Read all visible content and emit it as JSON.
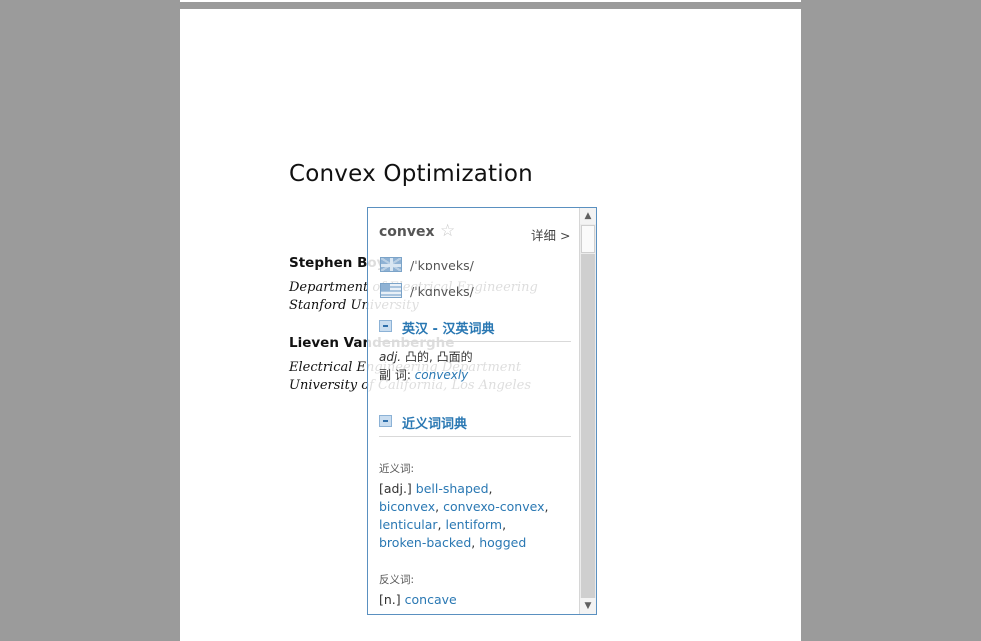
{
  "document": {
    "title": "Convex Optimization",
    "authors": [
      {
        "name": "Stephen Boyd",
        "affiliation": [
          "Department of Electrical Engineering",
          "Stanford University"
        ]
      },
      {
        "name": "Lieven Vandenberghe",
        "affiliation": [
          "Electrical Engineering Department",
          "University of California, Los Angeles"
        ]
      }
    ]
  },
  "popup": {
    "word": "convex",
    "detail_label": "详细 >",
    "phonetic_uk": "/ˈkɒnveks/",
    "phonetic_us": "/ˈkɑnveks/",
    "sections": [
      {
        "title": "英汉 - 汉英词典"
      },
      {
        "title": "近义词词典"
      }
    ],
    "definition": {
      "pos": "adj.",
      "text": "凸的, 凸面的"
    },
    "derived": {
      "label": "副 词:",
      "word": "convexly"
    },
    "synonyms": {
      "label": "近义词:",
      "pos": "[adj.]",
      "words": [
        "bell-shaped",
        "biconvex",
        "convexo-convex",
        "lenticular",
        "lentiform",
        "broken-backed",
        "hogged"
      ]
    },
    "antonyms": {
      "label": "反义词:",
      "pos": "[n.]",
      "words": [
        "concave"
      ]
    },
    "icons": {
      "star": "star-icon",
      "uk_flag": "uk-flag-icon",
      "us_flag": "us-flag-icon",
      "collapse": "collapse-minus-icon",
      "scroll_up": "scroll-up-arrow-icon",
      "scroll_down": "scroll-down-arrow-icon"
    },
    "accent_color": "#2a78b3"
  }
}
